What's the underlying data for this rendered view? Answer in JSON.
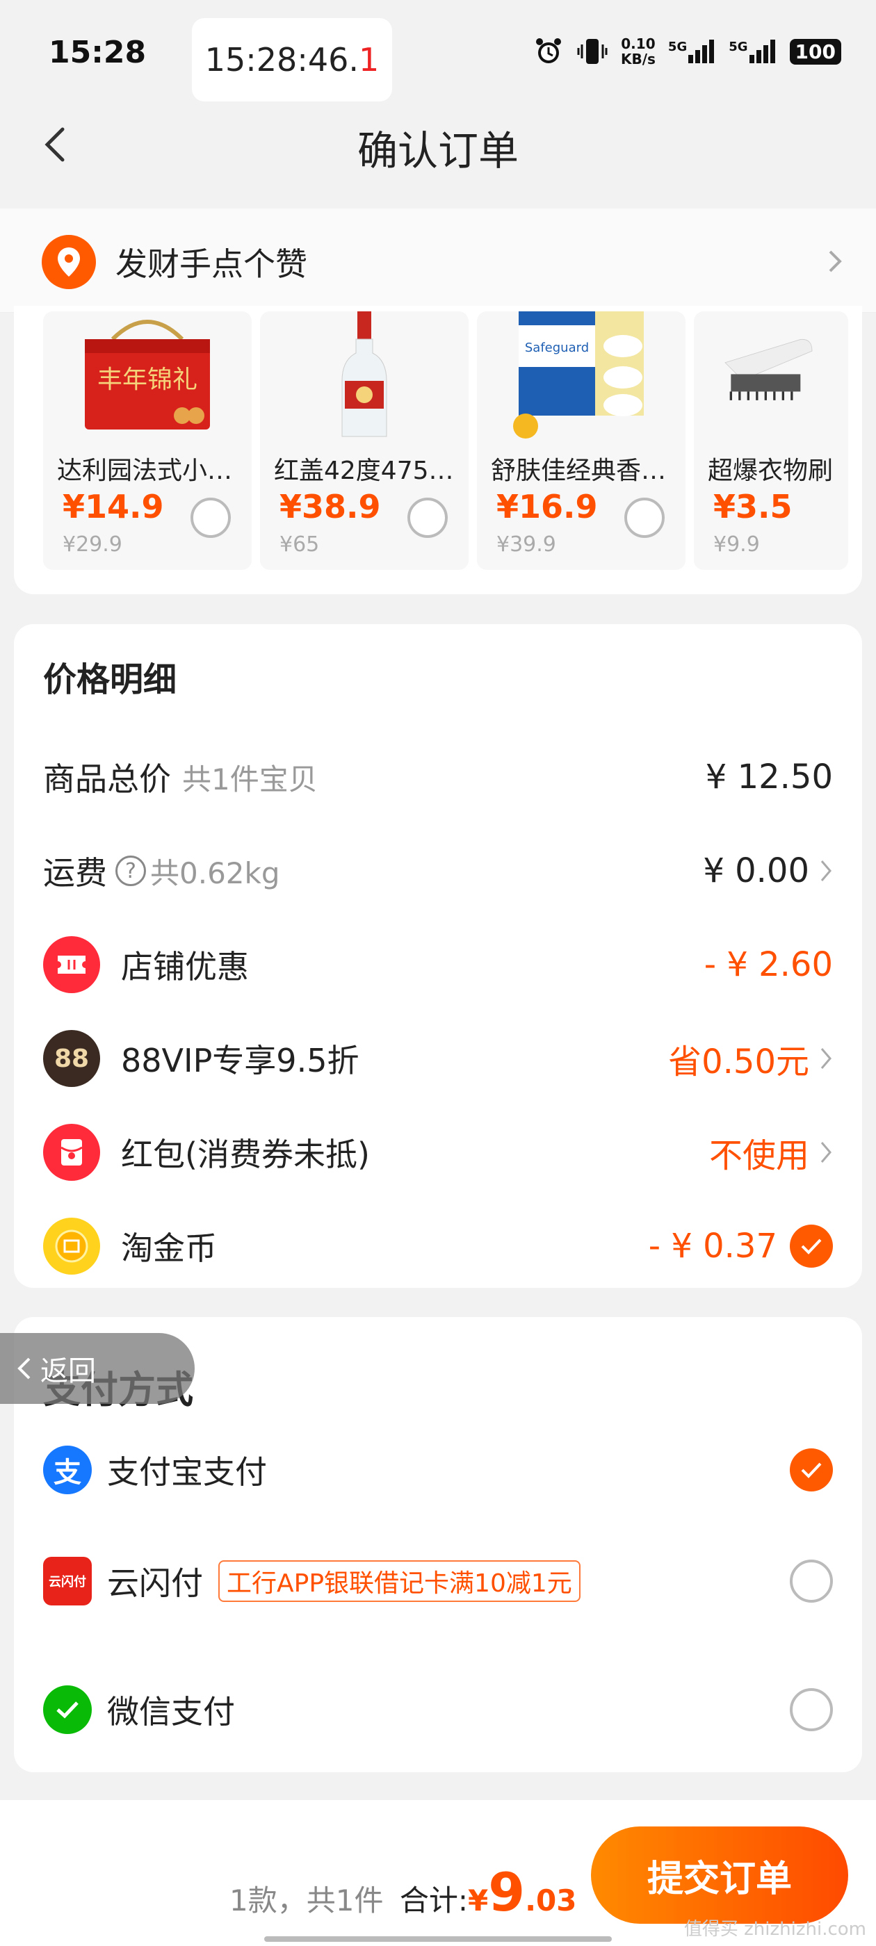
{
  "status_bar": {
    "time": "15:28",
    "clock_main": "15:28:46.",
    "clock_red": "1",
    "net_speed": "0.10",
    "net_unit": "KB/s",
    "sig1": "5G",
    "sig2": "5G",
    "battery": "100"
  },
  "header": {
    "title": "确认订单"
  },
  "address": {
    "name": "发财手点个赞"
  },
  "products": [
    {
      "name": "达利园法式小…",
      "price": "¥14.9",
      "orig": "¥29.9"
    },
    {
      "name": "红盖42度475…",
      "price": "¥38.9",
      "orig": "¥65"
    },
    {
      "name": "舒肤佳经典香…",
      "price": "¥16.9",
      "orig": "¥39.9"
    },
    {
      "name": "超爆衣物刷",
      "price": "¥3.5",
      "orig": "¥9.9"
    }
  ],
  "price_detail": {
    "title": "价格明细",
    "total_label": "商品总价",
    "total_sub": "共1件宝贝",
    "total_value": "¥ 12.50",
    "shipping_label": "运费",
    "shipping_sub": "共0.62kg",
    "shipping_value": "¥ 0.00",
    "shop_label": "店铺优惠",
    "shop_value": "- ¥ 2.60",
    "vip_label": "88VIP专享9.5折",
    "vip_value": "省0.50元",
    "vip_icon": "88",
    "redpack_label": "红包(消费券未抵)",
    "redpack_value": "不使用",
    "coin_label": "淘金币",
    "coin_value": "- ¥ 0.37"
  },
  "payment": {
    "title": "支付方式",
    "back_float": "返回",
    "alipay": "支付宝支付",
    "unionpay": "云闪付",
    "unionpay_icon": "云闪付",
    "unionpay_promo": "工行APP银联借记卡满10减1元",
    "wechat": "微信支付"
  },
  "footer": {
    "count": "1款，共1件",
    "total_label": "合计:",
    "currency": "¥",
    "int": "9",
    "dec": ".03",
    "submit": "提交订单",
    "watermark": "值得买 zhizhizhi.com"
  },
  "colors": {
    "accent": "#ff5000",
    "page_bg": "#f2f2f2"
  }
}
